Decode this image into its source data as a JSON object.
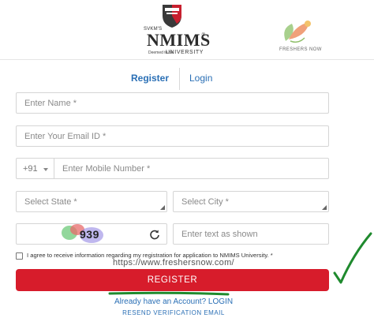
{
  "header": {
    "logo_small_text": "SVKM'S",
    "logo_name": "NMIMS",
    "logo_reg": "®",
    "logo_deemed": "Deemed to be",
    "logo_university": "UNIVERSITY",
    "partner_name": "FRESHERS NOW"
  },
  "tabs": {
    "register": "Register",
    "login": "Login"
  },
  "form": {
    "name_placeholder": "Enter Name *",
    "email_placeholder": "Enter Your Email ID *",
    "country_code": "+91",
    "mobile_placeholder": "Enter Mobile Number *",
    "state_label": "Select State *",
    "city_label": "Select City *",
    "captcha_text": "939",
    "captcha_input_placeholder": "Enter text as shown",
    "consent_text": "I agree to receive information regarding my registration for application to NMIMS University. *",
    "register_button": "REGISTER",
    "have_account": "Already have an Account? LOGIN",
    "resend": "RESEND VERIFICATION EMAIL"
  },
  "watermark": "https://www.freshersnow.com/",
  "colors": {
    "accent_blue": "#2a6fb5",
    "button_red": "#d71c2b",
    "annotation_green": "#1f8a2e"
  },
  "icons": {
    "captcha_refresh": "refresh-icon",
    "dropdown": "triangle-corner-icon",
    "annotation": "checkmark-icon"
  }
}
